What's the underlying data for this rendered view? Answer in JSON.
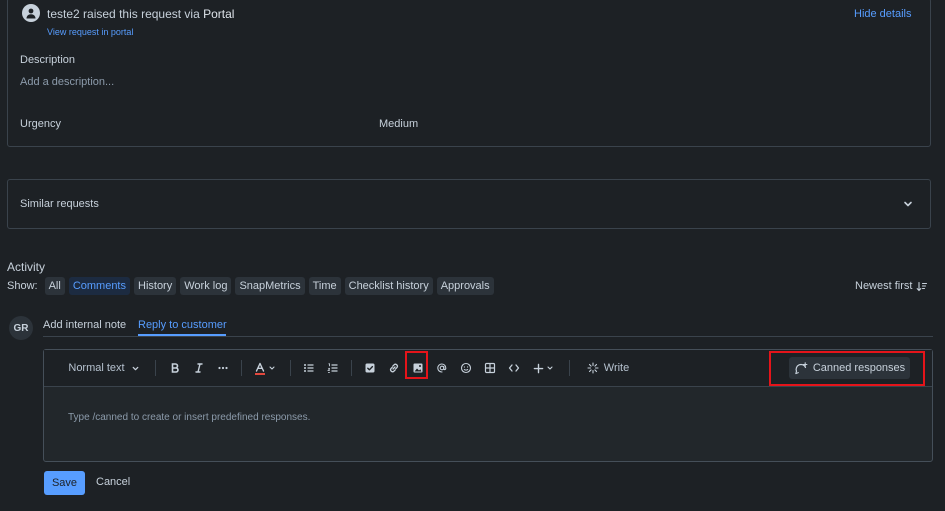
{
  "request": {
    "raised_by": "teste2",
    "raised_mid": "raised this request via",
    "raised_channel": "Portal",
    "view_link": "View request in portal",
    "hide_details": "Hide details"
  },
  "fields": {
    "description_label": "Description",
    "description_placeholder": "Add a description...",
    "urgency_label": "Urgency",
    "urgency_value": "Medium"
  },
  "similar": {
    "label": "Similar requests"
  },
  "activity": {
    "title": "Activity",
    "show_label": "Show:",
    "filters": [
      "All",
      "Comments",
      "History",
      "Work log",
      "SnapMetrics",
      "Time",
      "Checklist history",
      "Approvals"
    ],
    "active_filter": "Comments",
    "sort_label": "Newest first"
  },
  "composer": {
    "avatar_initials": "GR",
    "tab_internal": "Add internal note",
    "tab_reply": "Reply to customer",
    "text_style": "Normal text",
    "write_label": "Write",
    "canned_label": "Canned responses",
    "placeholder": "Type /canned to create or insert predefined responses.",
    "save_label": "Save",
    "cancel_label": "Cancel"
  },
  "colors": {
    "background": "#1d2125",
    "accent": "#579dff",
    "highlight": "#e5141a"
  }
}
